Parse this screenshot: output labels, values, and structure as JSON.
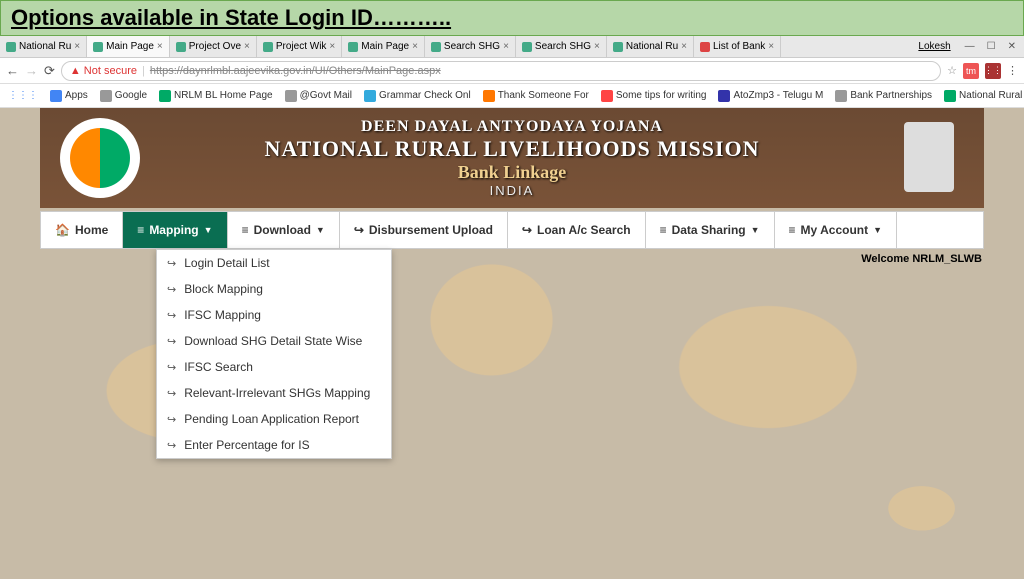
{
  "slide_title": "Options available in State Login ID………..",
  "tabs": [
    {
      "label": "National Ru",
      "fav": "green"
    },
    {
      "label": "Main Page",
      "fav": "green",
      "active": true
    },
    {
      "label": "Project Ove",
      "fav": "green"
    },
    {
      "label": "Project Wik",
      "fav": "green"
    },
    {
      "label": "Main Page",
      "fav": "green"
    },
    {
      "label": "Search SHG",
      "fav": "green"
    },
    {
      "label": "Search SHG",
      "fav": "green"
    },
    {
      "label": "National Ru",
      "fav": "green"
    },
    {
      "label": "List of Bank",
      "fav": "gmail"
    }
  ],
  "window_user": "Lokesh",
  "address": {
    "not_secure": "Not secure",
    "url": "https://daynrlmbl.aajeevika.gov.in/UI/Others/MainPage.aspx"
  },
  "bookmarks": [
    {
      "label": "Apps",
      "color": "#4285f4"
    },
    {
      "label": "Google",
      "color": "#999"
    },
    {
      "label": "NRLM BL Home Page",
      "color": "#0a6"
    },
    {
      "label": "@Govt Mail",
      "color": "#999"
    },
    {
      "label": "Grammar Check Onl",
      "color": "#3ad"
    },
    {
      "label": "Thank Someone For",
      "color": "#f70"
    },
    {
      "label": "Some tips for writing",
      "color": "#f44"
    },
    {
      "label": "AtoZmp3 - Telugu M",
      "color": "#33a"
    },
    {
      "label": "Bank Partnerships",
      "color": "#999"
    },
    {
      "label": "National Rural Livelih",
      "color": "#0a6"
    }
  ],
  "banner": {
    "line1": "DEEN DAYAL ANTYODAYA YOJANA",
    "line2": "NATIONAL RURAL LIVELIHOODS MISSION",
    "line3": "Bank Linkage",
    "line4": "INDIA"
  },
  "menu": [
    {
      "icon": "🏠",
      "label": "Home"
    },
    {
      "icon": "≡",
      "label": "Mapping",
      "caret": true,
      "active": true
    },
    {
      "icon": "≡",
      "label": "Download",
      "caret": true
    },
    {
      "icon": "↪",
      "label": "Disbursement Upload"
    },
    {
      "icon": "↪",
      "label": "Loan A/c Search"
    },
    {
      "icon": "≡",
      "label": "Data Sharing",
      "caret": true
    },
    {
      "icon": "≡",
      "label": "My Account",
      "caret": true
    }
  ],
  "welcome": "Welcome NRLM_SLWB",
  "dropdown": [
    "Login Detail List",
    "Block Mapping",
    "IFSC Mapping",
    "Download SHG Detail State Wise",
    "IFSC Search",
    "Relevant-Irrelevant SHGs Mapping",
    "Pending Loan Application Report",
    "Enter Percentage for IS"
  ]
}
